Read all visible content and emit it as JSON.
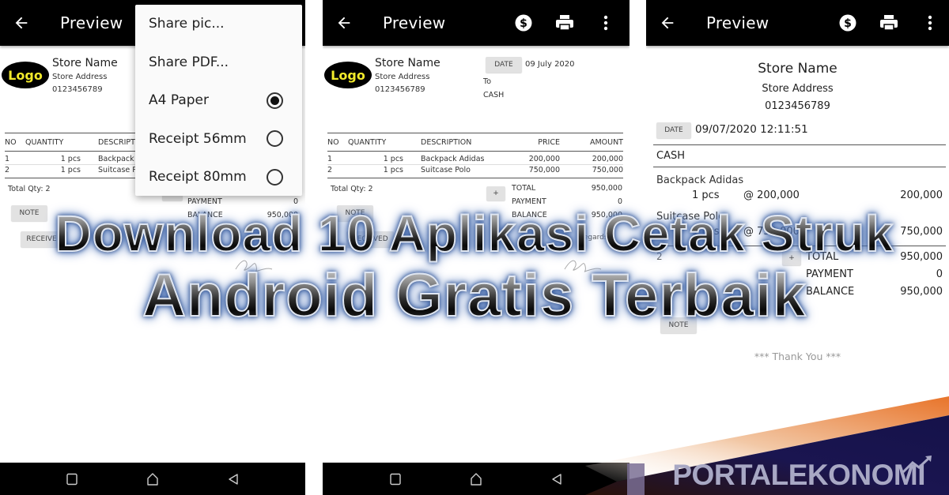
{
  "common": {
    "appbar_title": "Preview",
    "icons": {
      "back": "arrow-left-icon",
      "payment": "dollar-circle-icon",
      "print": "printer-icon",
      "more": "more-vertical-icon"
    },
    "navbar_icons": [
      "recents-square-icon",
      "home-icon",
      "back-triangle-icon"
    ]
  },
  "panel1": {
    "logo_text": "Logo",
    "store": {
      "name": "Store Name",
      "address": "Store Address",
      "phone": "0123456789"
    },
    "menu": {
      "items": [
        {
          "label": "Share pic...",
          "type": "action"
        },
        {
          "label": "Share PDF...",
          "type": "action"
        },
        {
          "label": "A4 Paper",
          "type": "radio",
          "selected": true
        },
        {
          "label": "Receipt 56mm",
          "type": "radio",
          "selected": false
        },
        {
          "label": "Receipt 80mm",
          "type": "radio",
          "selected": false
        }
      ]
    },
    "table": {
      "headers": [
        "NO",
        "QUANTITY",
        "DESCRIPTIO"
      ],
      "rows": [
        {
          "no": "1",
          "qty": "1 pcs",
          "desc": "Backpack Ad"
        },
        {
          "no": "2",
          "qty": "1 pcs",
          "desc": "Suitcase Pol"
        }
      ]
    },
    "total_qty": "Total Qty: 2",
    "summary": [
      {
        "label": "PAYMENT",
        "value": "0"
      },
      {
        "label": "BALANCE",
        "value": "950,000"
      }
    ],
    "note_label": "NOTE",
    "received_label": "RECEIVED"
  },
  "panel2": {
    "logo_text": "Logo",
    "store": {
      "name": "Store Name",
      "address": "Store Address",
      "phone": "0123456789"
    },
    "date_label": "DATE",
    "date_value": "09 July 2020",
    "to_label": "To",
    "customer": "CASH",
    "table": {
      "headers": [
        "NO",
        "QUANTITY",
        "DESCRIPTION",
        "PRICE",
        "AMOUNT"
      ],
      "rows": [
        {
          "no": "1",
          "qty": "1 pcs",
          "desc": "Backpack Adidas",
          "price": "200,000",
          "amount": "200,000"
        },
        {
          "no": "2",
          "qty": "1 pcs",
          "desc": "Suitcase Polo",
          "price": "750,000",
          "amount": "750,000"
        }
      ]
    },
    "total_qty": "Total Qty: 2",
    "add_label": "+",
    "summary": [
      {
        "label": "TOTAL",
        "value": "950,000"
      },
      {
        "label": "PAYMENT",
        "value": "0"
      },
      {
        "label": "BALANCE",
        "value": "950,000"
      }
    ],
    "note_label": "NOTE",
    "received_label": "RECEIVED",
    "regards_label": "Regards"
  },
  "panel3": {
    "store": {
      "name": "Store Name",
      "address": "Store Address",
      "phone": "0123456789"
    },
    "date_label": "DATE",
    "date_value": "09/07/2020 12:11:51",
    "customer": "CASH",
    "items": [
      {
        "name": "Backpack Adidas",
        "qty": "1 pcs",
        "price": "@ 200,000",
        "amount": "200,000"
      },
      {
        "name": "Suitcase Polo",
        "qty": "1 pcs",
        "price": "@ 750,000",
        "amount": "750,000"
      }
    ],
    "total_qty": "2",
    "add_label": "+",
    "summary": [
      {
        "label": "TOTAL",
        "value": "950,000"
      },
      {
        "label": "PAYMENT",
        "value": "0"
      },
      {
        "label": "BALANCE",
        "value": "950,000"
      }
    ],
    "note_label": "NOTE",
    "thanks": "*** Thank You ***"
  },
  "overlay": {
    "line1": "Download 10 Aplikasi Cetak Struk",
    "line2": "Android Gratis Terbaik"
  },
  "brand": {
    "name": "PORTALEKONOMI",
    "colors": {
      "navy": "#1a1550",
      "orange": "#e8742a",
      "text": "#a8a8c4"
    }
  }
}
